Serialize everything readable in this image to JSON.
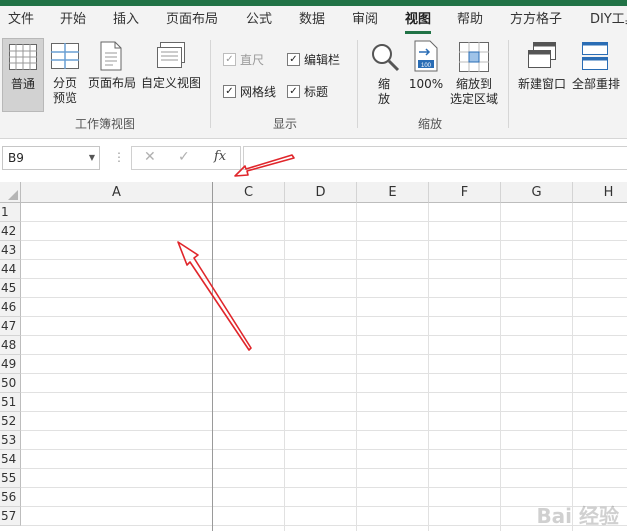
{
  "ribbon_tabs": [
    "文件",
    "开始",
    "插入",
    "页面布局",
    "公式",
    "数据",
    "审阅",
    "视图",
    "帮助",
    "方方格子",
    "DIY工具"
  ],
  "active_tab": "视图",
  "workbook_views": {
    "normal": "普通",
    "page_break_line1": "分页",
    "page_break_line2": "预览",
    "page_layout": "页面布局",
    "custom_views": "自定义视图",
    "group_label": "工作簿视图"
  },
  "show": {
    "ruler": "直尺",
    "formula_bar": "编辑栏",
    "gridlines": "网格线",
    "headings": "标题",
    "group_label": "显示"
  },
  "zoom": {
    "zoom_line1": "缩",
    "zoom_line2": "放",
    "hundred": "100%",
    "zoom_sel_line1": "缩放到",
    "zoom_sel_line2": "选定区域",
    "group_label": "缩放"
  },
  "window": {
    "new_window": "新建窗口",
    "arrange_all": "全部重排"
  },
  "formula_bar": {
    "name_box": "B9",
    "fx": "fx",
    "content": ""
  },
  "columns": [
    "A",
    "C",
    "D",
    "E",
    "F",
    "G",
    "H"
  ],
  "rows": [
    "1",
    "42",
    "43",
    "44",
    "45",
    "46",
    "47",
    "48",
    "49",
    "50",
    "51",
    "52",
    "53",
    "54",
    "55",
    "56",
    "57"
  ],
  "watermark": "Bai 经验",
  "colors": {
    "accent": "#217346",
    "annotation": "#e0262b"
  }
}
